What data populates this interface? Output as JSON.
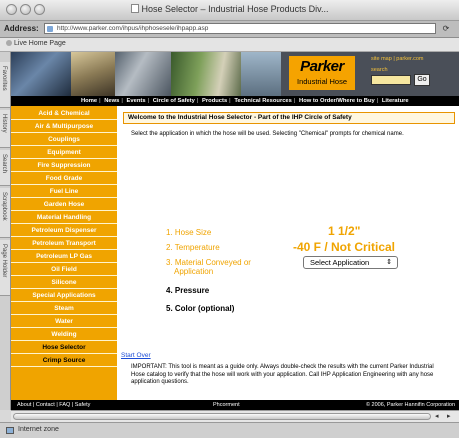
{
  "window": {
    "title": "Hose Selector – Industrial Hose Products Div..."
  },
  "address_bar": {
    "label": "Address:",
    "url": "http://www.parker.com/ihpus/ihphosesele/ihpapp.asp"
  },
  "favorites_bar": {
    "item": "Live Home Page"
  },
  "side_tabs": [
    "Favorites",
    "History",
    "Search",
    "Scrapbook",
    "Page Holder"
  ],
  "banner": {
    "logo_word": "Parker",
    "logo_sub": "Industrial Hose",
    "util_links": "site map  |  parker.com",
    "search_label": "search",
    "go_label": "Go"
  },
  "top_nav": [
    "Home",
    "News",
    "Events",
    "Circle of Safety",
    "Products",
    "Technical Resources",
    "How to Order/Where to Buy",
    "Literature"
  ],
  "left_nav": [
    {
      "label": "Acid & Chemical"
    },
    {
      "label": "Air & Multipurpose"
    },
    {
      "label": "Couplings"
    },
    {
      "label": "Equipment"
    },
    {
      "label": "Fire Suppression"
    },
    {
      "label": "Food Grade"
    },
    {
      "label": "Fuel Line"
    },
    {
      "label": "Garden Hose"
    },
    {
      "label": "Material Handling"
    },
    {
      "label": "Petroleum Dispenser"
    },
    {
      "label": "Petroleum Transport"
    },
    {
      "label": "Petroleum LP Gas"
    },
    {
      "label": "Oil Field"
    },
    {
      "label": "Silicone"
    },
    {
      "label": "Special Applications"
    },
    {
      "label": "Steam"
    },
    {
      "label": "Water"
    },
    {
      "label": "Welding"
    },
    {
      "label": "Hose Selector"
    },
    {
      "label": "Crimp Source"
    }
  ],
  "content": {
    "header": "Welcome to the Industrial Hose Selector - Part of the IHP Circle of Safety",
    "intro": "Select the application in which the hose will be used. Selecting \"Chemical\" prompts for chemical name.",
    "steps": {
      "hose_size": "1. Hose Size",
      "temperature": "2. Temperature",
      "material_line1": "3. Material Conveyed or",
      "material_line2": "Application",
      "pressure": "4. Pressure",
      "color": "5. Color (optional)"
    },
    "values": {
      "hose_size": "1 1/2\"",
      "temperature": "-40 F / Not Critical"
    },
    "select_application": "Select Application",
    "start_over": "Start Over",
    "important": "IMPORTANT: This tool is meant as a guide only. Always double-check the results with the current Parker Industrial Hose catalog to verify that the hose will work with your application. Call IHP Application Engineering with any hose application questions."
  },
  "footer": {
    "left": "About  |  Contact  |  FAQ  |  Safety",
    "middle": "Phcorment",
    "right": "© 2006, Parker Hannifin Corporation"
  },
  "status": {
    "text": "Internet zone"
  },
  "colors": {
    "accent_orange": "#f0a400",
    "nav_black": "#000000",
    "link_blue": "#1a4bd6"
  }
}
